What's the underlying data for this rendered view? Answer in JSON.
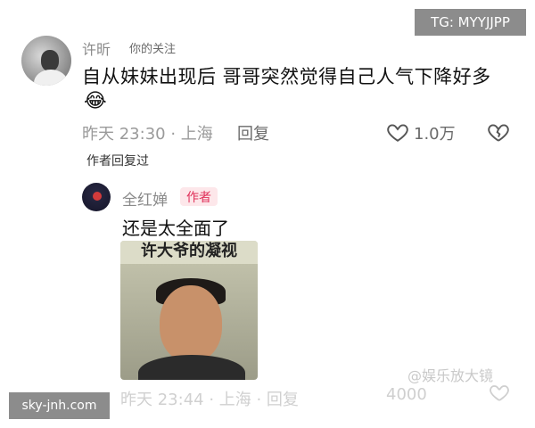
{
  "watermarks": {
    "top_right": "TG: MYYJJPP",
    "bottom_left": "sky-jnh.com",
    "overlay": "@娱乐放大镜"
  },
  "comment": {
    "username": "许昕",
    "follow_tag": "你的关注",
    "text": "自从妹妹出现后 哥哥突然觉得自己人气下降好多",
    "emoji": "😂",
    "time": "昨天 23:30",
    "location": "上海",
    "meta": "昨天 23:30 · 上海",
    "reply_label": "回复",
    "like_count": "1.0万",
    "author_replied": "作者回复过"
  },
  "reply": {
    "username": "全红婵",
    "badge": "作者",
    "text": "还是太全面了",
    "sticker_caption": "许大爷的凝视",
    "cut_meta": "昨天 23:44 · 上海 · 回复",
    "cut_like": "4000"
  },
  "colors": {
    "badge_bg": "#fde7ea",
    "badge_text": "#e0305a",
    "meta_gray": "#9a9a9a"
  },
  "icons": [
    "heart-outline-icon",
    "broken-heart-icon"
  ]
}
